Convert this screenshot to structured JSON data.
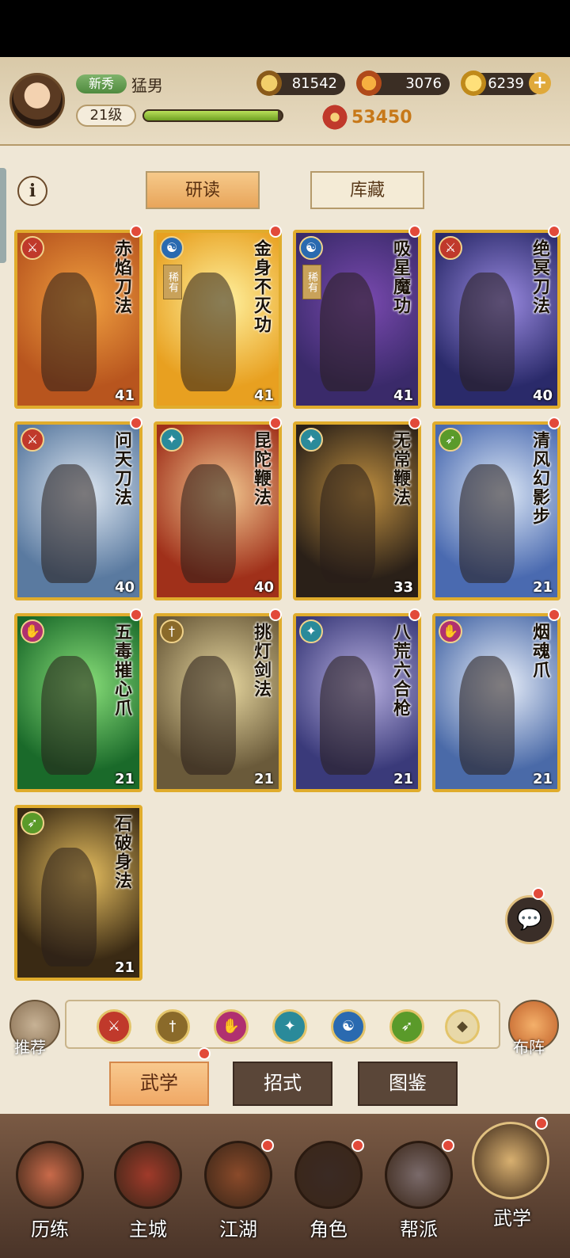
{
  "header": {
    "rank_badge": "新秀",
    "player_name": "猛男",
    "level": "21级",
    "exp_fraction": 0.97,
    "coins": "81542",
    "stamina": "3076",
    "gold": "6239",
    "power": "53450"
  },
  "tabs": {
    "study": "研读",
    "collection": "库藏"
  },
  "cards": [
    {
      "name": "赤焰刀法",
      "level": "41",
      "type_icon": "blade-icon",
      "rare": "",
      "bg": "#b8551e",
      "bg2": "#f0a040"
    },
    {
      "name": "金身不灭功",
      "level": "41",
      "type_icon": "taiji-icon",
      "rare": "稀有",
      "bg": "#e8a020",
      "bg2": "#fff2a0"
    },
    {
      "name": "吸星魔功",
      "level": "41",
      "type_icon": "taiji-icon",
      "rare": "稀有",
      "bg": "#3a2a6a",
      "bg2": "#7a4ab0"
    },
    {
      "name": "绝冥刀法",
      "level": "40",
      "type_icon": "blade-icon",
      "rare": "",
      "bg": "#2a2a6a",
      "bg2": "#9a8ae0"
    },
    {
      "name": "问天刀法",
      "level": "40",
      "type_icon": "blade-icon",
      "rare": "",
      "bg": "#5a7aa0",
      "bg2": "#dfe8f2"
    },
    {
      "name": "昆陀鞭法",
      "level": "40",
      "type_icon": "fan-icon",
      "rare": "",
      "bg": "#a0301a",
      "bg2": "#f2c890"
    },
    {
      "name": "无常鞭法",
      "level": "33",
      "type_icon": "fan-icon",
      "rare": "",
      "bg": "#2a2018",
      "bg2": "#c09040"
    },
    {
      "name": "清风幻影步",
      "level": "21",
      "type_icon": "step-icon",
      "rare": "",
      "bg": "#4a6ab0",
      "bg2": "#dde8f6"
    },
    {
      "name": "五毒摧心爪",
      "level": "21",
      "type_icon": "claw-icon",
      "rare": "",
      "bg": "#1a6a2a",
      "bg2": "#8ae07a"
    },
    {
      "name": "挑灯剑法",
      "level": "21",
      "type_icon": "sword-icon",
      "rare": "",
      "bg": "#6a5a3a",
      "bg2": "#e8d8a0"
    },
    {
      "name": "八荒六合枪",
      "level": "21",
      "type_icon": "fan-icon",
      "rare": "",
      "bg": "#3a3a7a",
      "bg2": "#b8b0e0"
    },
    {
      "name": "烟魂爪",
      "level": "21",
      "type_icon": "claw-icon",
      "rare": "",
      "bg": "#4a6aa8",
      "bg2": "#eaf0fa"
    },
    {
      "name": "石破身法",
      "level": "21",
      "type_icon": "step-icon",
      "rare": "",
      "bg": "#3a2a14",
      "bg2": "#e8c060"
    }
  ],
  "filters": [
    {
      "icon": "blade-icon",
      "color": "#c0392b"
    },
    {
      "icon": "sword-icon",
      "color": "#8a6a2a"
    },
    {
      "icon": "claw-icon",
      "color": "#b03070"
    },
    {
      "icon": "fan-icon",
      "color": "#2a8a9a"
    },
    {
      "icon": "taiji-icon",
      "color": "#2a6ab0"
    },
    {
      "icon": "step-icon",
      "color": "#5a9a2a"
    },
    {
      "icon": "other-icon",
      "color": "#e8d8a8"
    }
  ],
  "side": {
    "recommend": "推荐",
    "formation": "布阵"
  },
  "sub_tabs": {
    "martial": "武学",
    "moves": "招式",
    "catalog": "图鉴"
  },
  "nav": [
    "历练",
    "主城",
    "江湖",
    "角色",
    "帮派",
    "武学"
  ]
}
